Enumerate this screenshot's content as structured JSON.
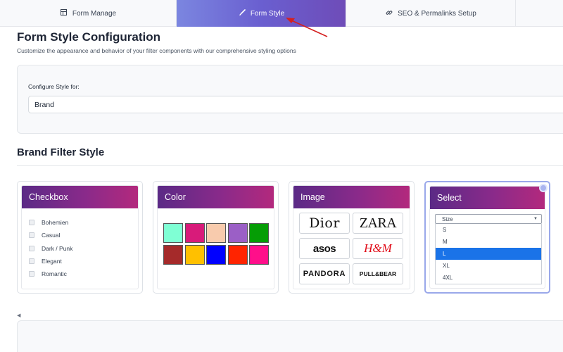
{
  "tabs": [
    {
      "label": "Form Manage",
      "icon": "form-grid-icon",
      "active": false
    },
    {
      "label": "Form Style",
      "icon": "paintbrush-icon",
      "active": true
    },
    {
      "label": "SEO & Permalinks Setup",
      "icon": "link-icon",
      "active": false
    },
    {
      "label": "",
      "active": false
    }
  ],
  "header": {
    "title": "Form Style Configuration",
    "subtitle": "Customize the appearance and behavior of your filter components with our comprehensive styling options"
  },
  "config": {
    "label": "Configure Style for:",
    "selected_value": "Brand"
  },
  "section": {
    "title": "Brand Filter Style"
  },
  "cards": {
    "checkbox": {
      "title": "Checkbox",
      "items": [
        "Bohemien",
        "Casual",
        "Dark / Punk",
        "Elegant",
        "Romantic"
      ]
    },
    "color": {
      "title": "Color",
      "swatches": [
        "#7fffd4",
        "#d81b7a",
        "#f8cbad",
        "#9b5fc6",
        "#059d05",
        "#a52a2a",
        "#ffc000",
        "#0000ff",
        "#ff2400",
        "#ff0f8a"
      ]
    },
    "image": {
      "title": "Image",
      "logos": [
        "Dior",
        "ZARA",
        "asos",
        "H&M",
        "PANDORA",
        "PULL&BEAR"
      ]
    },
    "select": {
      "title": "Select",
      "placeholder": "Size",
      "options": [
        "S",
        "M",
        "L",
        "XL",
        "4XL"
      ],
      "highlighted": "L",
      "selected_style": true
    }
  },
  "colors": {
    "tab_active_gradient": [
      "#7b86e0",
      "#6e4cb8"
    ],
    "card_header_gradient": [
      "#5b2a86",
      "#b3297d"
    ],
    "annotation_arrow": "#d42020"
  }
}
